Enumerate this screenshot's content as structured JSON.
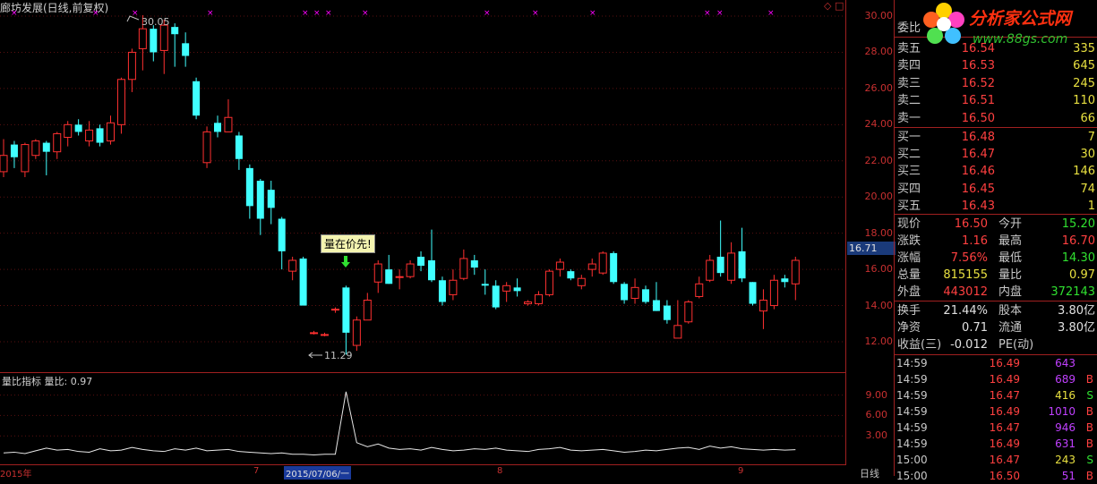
{
  "title": "廊坊发展(日线,前复权)",
  "window_controls": "◇ □",
  "markers": [
    "×",
    "×",
    "×",
    "×",
    "×",
    "×",
    "×",
    "×",
    "×",
    "×",
    "×",
    "×",
    "×",
    "×"
  ],
  "price_axis": {
    "ticks": [
      "30.00",
      "28.00",
      "26.00",
      "24.00",
      "22.00",
      "20.00",
      "18.00",
      "16.00",
      "14.00",
      "12.00"
    ],
    "current": "16.71"
  },
  "annotations": {
    "high": "30.05",
    "low": "11.29",
    "signal": "量在价先!"
  },
  "sub_chart": {
    "title": "量比指标  量比: 0.97",
    "ticks": [
      "9.00",
      "6.00",
      "3.00"
    ]
  },
  "dates": {
    "d1": "2015年",
    "d2": "7",
    "d3": "2015/07/06/一",
    "d4": "8",
    "d5": "9"
  },
  "period": "日线",
  "logo": {
    "text": "分析家公式网",
    "url": "www.88gs.com"
  },
  "panel": {
    "header": "委比",
    "sell": [
      {
        "label": "卖五",
        "price": "16.54",
        "vol": "335"
      },
      {
        "label": "卖四",
        "price": "16.53",
        "vol": "645"
      },
      {
        "label": "卖三",
        "price": "16.52",
        "vol": "245"
      },
      {
        "label": "卖二",
        "price": "16.51",
        "vol": "110"
      },
      {
        "label": "卖一",
        "price": "16.50",
        "vol": "66"
      }
    ],
    "buy": [
      {
        "label": "买一",
        "price": "16.48",
        "vol": "7"
      },
      {
        "label": "买二",
        "price": "16.47",
        "vol": "30"
      },
      {
        "label": "买三",
        "price": "16.46",
        "vol": "146"
      },
      {
        "label": "买四",
        "price": "16.45",
        "vol": "74"
      },
      {
        "label": "买五",
        "price": "16.43",
        "vol": "1"
      }
    ],
    "info": [
      {
        "l1": "现价",
        "v1": "16.50",
        "l2": "今开",
        "v2": "15.20",
        "c1": "#ff4040",
        "c2": "#30e030"
      },
      {
        "l1": "涨跌",
        "v1": "1.16",
        "l2": "最高",
        "v2": "16.70",
        "c1": "#ff4040",
        "c2": "#ff4040"
      },
      {
        "l1": "涨幅",
        "v1": "7.56%",
        "l2": "最低",
        "v2": "14.30",
        "c1": "#ff4040",
        "c2": "#30e030"
      },
      {
        "l1": "总量",
        "v1": "815155",
        "l2": "量比",
        "v2": "0.97",
        "c1": "#e8e040",
        "c2": "#e8e040"
      },
      {
        "l1": "外盘",
        "v1": "443012",
        "l2": "内盘",
        "v2": "372143",
        "c1": "#ff4040",
        "c2": "#30e030"
      }
    ],
    "info2": [
      {
        "l1": "换手",
        "v1": "21.44%",
        "l2": "股本",
        "v2": "3.80亿",
        "c1": "#e0e0e0",
        "c2": "#e0e0e0"
      },
      {
        "l1": "净资",
        "v1": "0.71",
        "l2": "流通",
        "v2": "3.80亿",
        "c1": "#e0e0e0",
        "c2": "#e0e0e0"
      },
      {
        "l1": "收益(三)",
        "v1": "-0.012",
        "l2": "PE(动)",
        "v2": "",
        "c1": "#e0e0e0",
        "c2": "#e0e0e0"
      }
    ],
    "ticks": [
      {
        "t": "14:59",
        "p": "16.49",
        "v": "643",
        "d": "",
        "vc": "#c040ff"
      },
      {
        "t": "14:59",
        "p": "16.49",
        "v": "689",
        "d": "B",
        "vc": "#c040ff"
      },
      {
        "t": "14:59",
        "p": "16.47",
        "v": "416",
        "d": "S",
        "vc": "#e8e040"
      },
      {
        "t": "14:59",
        "p": "16.49",
        "v": "1010",
        "d": "B",
        "vc": "#c040ff"
      },
      {
        "t": "14:59",
        "p": "16.47",
        "v": "946",
        "d": "B",
        "vc": "#c040ff"
      },
      {
        "t": "14:59",
        "p": "16.49",
        "v": "631",
        "d": "B",
        "vc": "#c040ff"
      },
      {
        "t": "15:00",
        "p": "16.47",
        "v": "243",
        "d": "S",
        "vc": "#e8e040"
      },
      {
        "t": "15:00",
        "p": "16.50",
        "v": "51",
        "d": "B",
        "vc": "#c040ff"
      }
    ]
  },
  "chart_data": {
    "type": "candlestick",
    "title": "廊坊发展(日线,前复权)",
    "ylim": [
      11,
      30.5
    ],
    "up_color": "#ff3030",
    "down_color": "#40ffff",
    "candles": [
      [
        21.4,
        22.3,
        21.1,
        23.2
      ],
      [
        22.9,
        22.2,
        21.6,
        23.1
      ],
      [
        21.4,
        22.9,
        21.1,
        23.0
      ],
      [
        22.3,
        23.1,
        22.1,
        23.2
      ],
      [
        23.0,
        22.5,
        21.2,
        23.1
      ],
      [
        22.5,
        23.5,
        22.1,
        23.6
      ],
      [
        23.3,
        24.0,
        22.8,
        24.2
      ],
      [
        24.0,
        23.6,
        23.4,
        24.3
      ],
      [
        23.1,
        23.7,
        22.8,
        24.2
      ],
      [
        23.8,
        23.0,
        22.8,
        24.0
      ],
      [
        23.1,
        24.1,
        22.9,
        24.5
      ],
      [
        24.0,
        26.5,
        23.5,
        26.6
      ],
      [
        26.5,
        28.0,
        25.8,
        28.2
      ],
      [
        28.2,
        29.3,
        27.0,
        30.05
      ],
      [
        29.3,
        28.0,
        27.5,
        29.5
      ],
      [
        28.1,
        29.5,
        26.8,
        29.8
      ],
      [
        29.4,
        29.0,
        27.2,
        29.6
      ],
      [
        28.5,
        27.8,
        27.2,
        29.1
      ],
      [
        26.4,
        24.5,
        24.3,
        26.6
      ],
      [
        21.9,
        23.6,
        21.6,
        23.9
      ],
      [
        24.1,
        23.6,
        23.3,
        24.5
      ],
      [
        23.6,
        24.4,
        23.6,
        25.4
      ],
      [
        23.4,
        22.1,
        21.5,
        23.6
      ],
      [
        21.6,
        19.5,
        18.8,
        21.8
      ],
      [
        20.9,
        18.8,
        17.9,
        21.0
      ],
      [
        20.4,
        19.4,
        18.5,
        20.9
      ],
      [
        18.8,
        17.0,
        16.0,
        18.9
      ],
      [
        15.9,
        16.5,
        15.4,
        16.7
      ],
      [
        16.6,
        14.0,
        14.0,
        16.7
      ],
      [
        12.5,
        12.5,
        12.4,
        12.6
      ],
      [
        12.4,
        12.4,
        12.3,
        12.5
      ],
      [
        13.8,
        13.8,
        13.6,
        13.9
      ],
      [
        15.0,
        12.5,
        11.29,
        15.1
      ],
      [
        11.8,
        13.2,
        11.5,
        13.4
      ],
      [
        13.2,
        14.3,
        13.2,
        14.7
      ],
      [
        15.3,
        16.3,
        14.7,
        16.5
      ],
      [
        16.0,
        15.2,
        15.2,
        16.8
      ],
      [
        15.6,
        15.6,
        14.9,
        16.0
      ],
      [
        15.6,
        16.3,
        15.5,
        16.5
      ],
      [
        16.7,
        16.2,
        15.9,
        17.0
      ],
      [
        16.5,
        15.4,
        15.3,
        18.2
      ],
      [
        15.4,
        14.2,
        14.0,
        15.6
      ],
      [
        14.6,
        15.4,
        14.3,
        16.0
      ],
      [
        15.5,
        16.6,
        15.4,
        17.1
      ],
      [
        16.5,
        16.1,
        15.7,
        16.8
      ],
      [
        15.2,
        15.1,
        14.6,
        16.0
      ],
      [
        15.1,
        13.9,
        13.8,
        15.4
      ],
      [
        14.8,
        15.1,
        14.2,
        15.3
      ],
      [
        15.0,
        14.8,
        14.5,
        15.5
      ],
      [
        14.1,
        14.2,
        14.0,
        14.3
      ],
      [
        14.1,
        14.6,
        14.0,
        14.8
      ],
      [
        14.6,
        15.9,
        14.5,
        16.0
      ],
      [
        16.0,
        16.4,
        15.6,
        16.6
      ],
      [
        15.9,
        15.5,
        15.4,
        16.0
      ],
      [
        15.1,
        15.5,
        14.9,
        15.7
      ],
      [
        16.0,
        16.3,
        15.6,
        16.6
      ],
      [
        15.8,
        16.9,
        15.7,
        17.0
      ],
      [
        16.9,
        15.3,
        15.2,
        17.0
      ],
      [
        15.2,
        14.3,
        14.1,
        15.3
      ],
      [
        14.4,
        15.0,
        14.1,
        15.5
      ],
      [
        14.9,
        14.2,
        14.1,
        15.1
      ],
      [
        14.3,
        13.7,
        13.7,
        15.3
      ],
      [
        14.0,
        13.2,
        13.0,
        14.3
      ],
      [
        12.2,
        12.9,
        12.2,
        14.3
      ],
      [
        13.1,
        14.2,
        13.0,
        14.3
      ],
      [
        14.5,
        15.2,
        14.4,
        15.6
      ],
      [
        15.4,
        16.5,
        15.3,
        16.8
      ],
      [
        16.7,
        15.8,
        15.6,
        18.7
      ],
      [
        15.4,
        16.9,
        15.2,
        17.5
      ],
      [
        17.0,
        15.5,
        15.3,
        18.3
      ],
      [
        15.3,
        14.1,
        14.0,
        15.3
      ],
      [
        13.7,
        14.3,
        12.7,
        14.9
      ],
      [
        14.0,
        15.4,
        13.8,
        15.7
      ],
      [
        15.5,
        15.3,
        15.0,
        15.7
      ],
      [
        15.2,
        16.5,
        14.3,
        16.7
      ]
    ],
    "volume_ratio": [
      0.5,
      0.6,
      0.4,
      0.8,
      1.2,
      0.9,
      1.0,
      0.7,
      0.6,
      1.1,
      0.8,
      0.9,
      1.3,
      1.0,
      0.8,
      0.7,
      1.1,
      0.9,
      1.2,
      0.8,
      0.9,
      1.0,
      0.7,
      0.6,
      0.5,
      0.4,
      0.5,
      0.3,
      0.3,
      0.2,
      0.3,
      0.3,
      9.5,
      2.0,
      1.4,
      1.8,
      1.2,
      1.0,
      1.1,
      0.9,
      1.3,
      1.0,
      0.8,
      0.9,
      1.1,
      1.0,
      1.2,
      0.9,
      0.8,
      0.7,
      1.0,
      1.1,
      1.3,
      0.9,
      0.8,
      0.9,
      1.0,
      0.8,
      0.6,
      0.7,
      0.9,
      0.8,
      1.0,
      1.2,
      1.3,
      1.0,
      1.5,
      1.2,
      1.4,
      1.1,
      1.0,
      0.9,
      1.0,
      0.9,
      0.97
    ]
  }
}
